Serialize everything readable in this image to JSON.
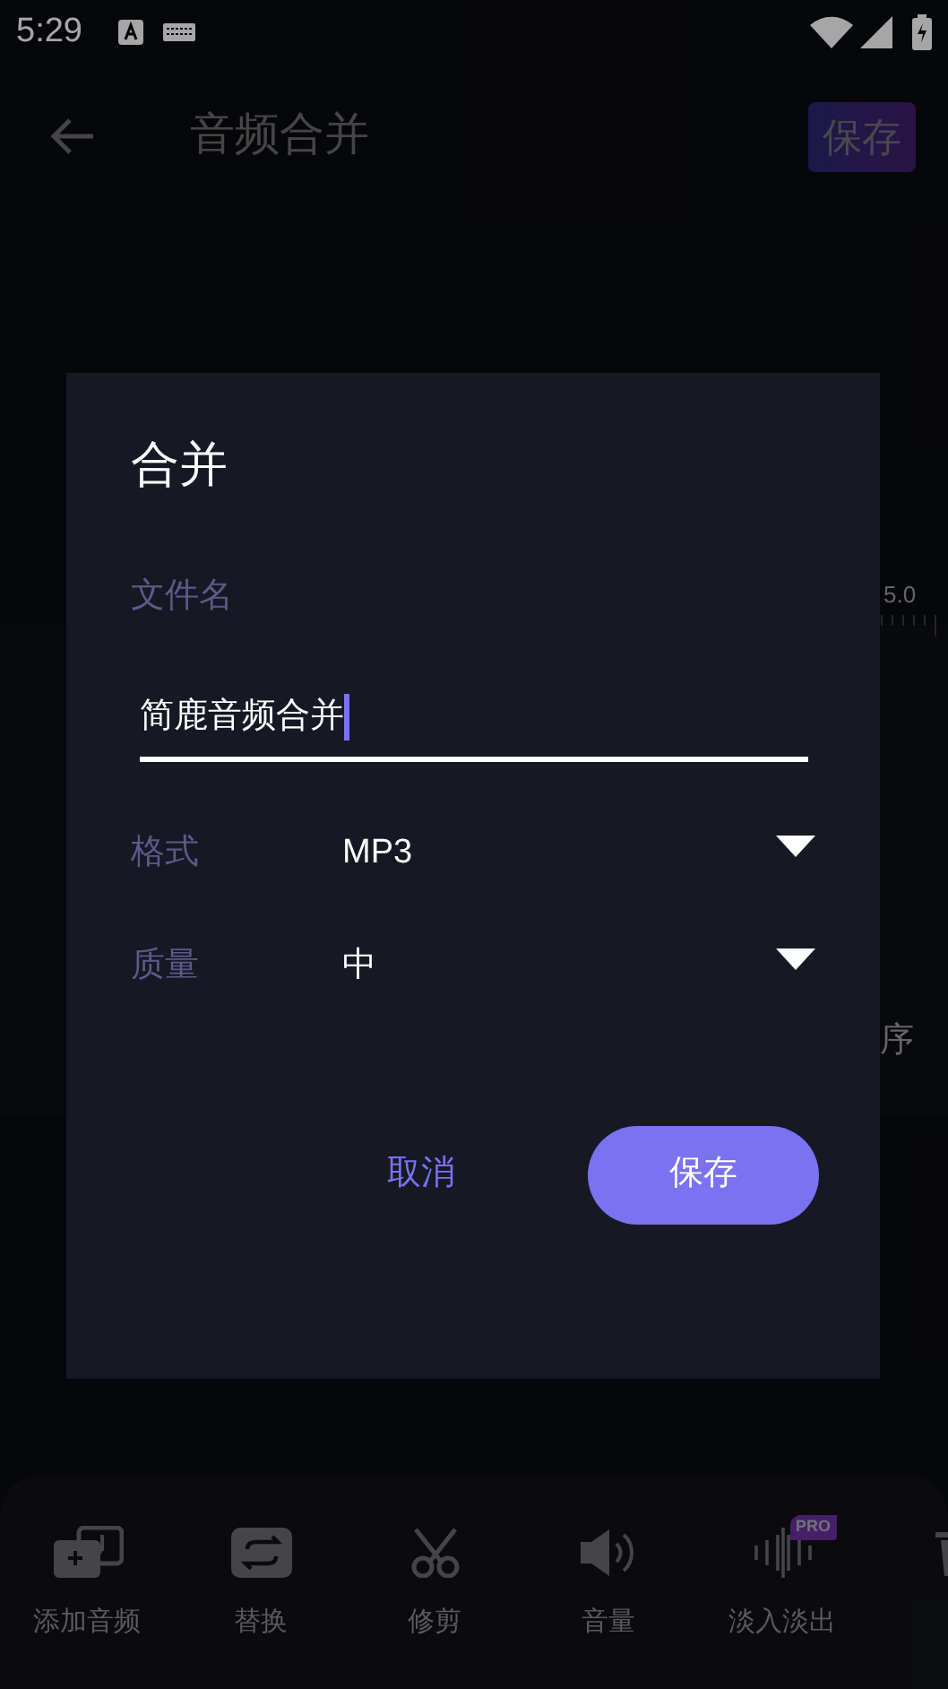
{
  "status_bar": {
    "time": "5:29"
  },
  "app_bar": {
    "title": "音频合并",
    "save": "保存"
  },
  "background": {
    "ruler_label": "5.0",
    "side_label": "序"
  },
  "dialog": {
    "title": "合并",
    "filename_label": "文件名",
    "filename_value": "简鹿音频合并",
    "options": [
      {
        "label": "格式",
        "value": "MP3"
      },
      {
        "label": "质量",
        "value": "中"
      }
    ],
    "cancel": "取消",
    "confirm": "保存"
  },
  "toolbar": [
    {
      "kind": "add",
      "label": "添加音频"
    },
    {
      "kind": "replace",
      "label": "替换"
    },
    {
      "kind": "trim",
      "label": "修剪"
    },
    {
      "kind": "volume",
      "label": "音量"
    },
    {
      "kind": "fade",
      "label": "淡入淡出",
      "badge": "PRO"
    },
    {
      "kind": "delete"
    }
  ]
}
